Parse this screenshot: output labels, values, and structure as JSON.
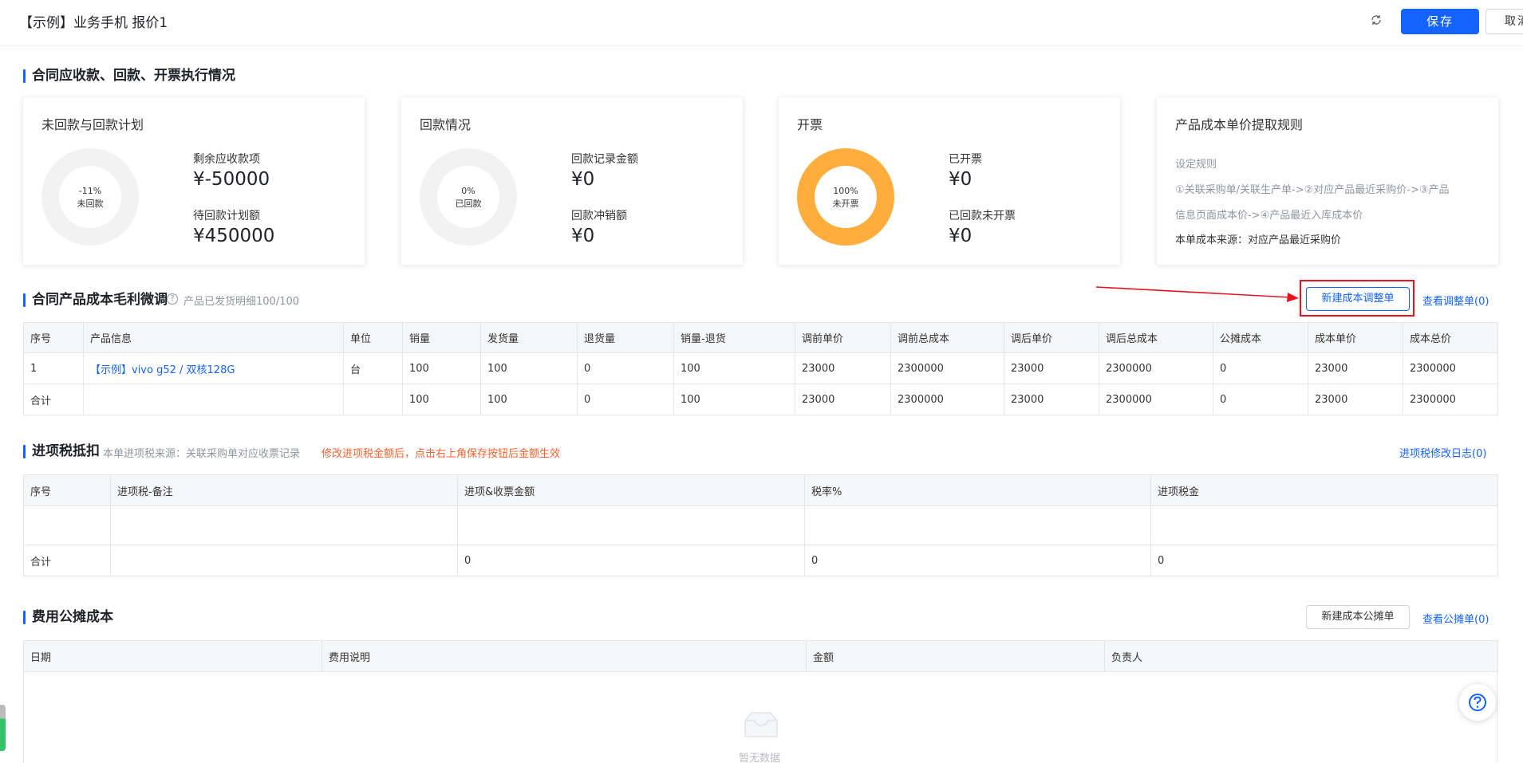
{
  "header": {
    "title": "【示例】业务手机 报价1",
    "refresh_icon": "refresh-icon",
    "save_label": "保存",
    "cancel_label": "取消"
  },
  "section1": {
    "title": "合同应收款、回款、开票执行情况",
    "cards": [
      {
        "title": "未回款与回款计划",
        "donut_percent": "-11%",
        "donut_label": "未回款",
        "donut_fill": 0,
        "stat1_label": "剩余应收款项",
        "stat1_value": "¥-50000",
        "stat2_label": "待回款计划额",
        "stat2_value": "¥450000"
      },
      {
        "title": "回款情况",
        "donut_percent": "0%",
        "donut_label": "已回款",
        "donut_fill": 0,
        "stat1_label": "回款记录金额",
        "stat1_value": "¥0",
        "stat2_label": "回款冲销额",
        "stat2_value": "¥0"
      },
      {
        "title": "开票",
        "donut_percent": "100%",
        "donut_label": "未开票",
        "donut_fill": 1,
        "stat1_label": "已开票",
        "stat1_value": "¥0",
        "stat2_label": "已回款未开票",
        "stat2_value": "¥0"
      }
    ],
    "rule_card": {
      "title": "产品成本单价提取规则",
      "rule_label": "设定规则",
      "rule_line1": "①关联采购单/关联生产单->②对应产品最近采购价->③产品",
      "rule_line2": "信息页面成本价->④产品最近入库成本价",
      "source": "本单成本来源：对应产品最近采购价"
    }
  },
  "section2": {
    "title": "合同产品成本毛利微调",
    "hint": "产品已发货明细100/100",
    "new_button": "新建成本调整单",
    "view_link": "查看调整单(0)",
    "columns": [
      "序号",
      "产品信息",
      "单位",
      "销量",
      "发货量",
      "退货量",
      "销量-退货",
      "调前单价",
      "调前总成本",
      "调后单价",
      "调后总成本",
      "公摊成本",
      "成本单价",
      "成本总价"
    ],
    "rows": [
      [
        "1",
        "【示例】vivo g52 / 双核128G",
        "台",
        "100",
        "100",
        "0",
        "100",
        "23000",
        "2300000",
        "23000",
        "2300000",
        "0",
        "23000",
        "2300000"
      ],
      [
        "合计",
        "",
        "",
        "100",
        "100",
        "0",
        "100",
        "23000",
        "2300000",
        "23000",
        "2300000",
        "0",
        "23000",
        "2300000"
      ]
    ]
  },
  "section3": {
    "title": "进项税抵扣",
    "hint": "本单进项税来源：关联采购单对应收票记录",
    "warn": "修改进项税金额后，点击右上角保存按钮后金额生效",
    "log_link": "进项税修改日志(0)",
    "columns": [
      "序号",
      "进项税-备注",
      "进项&收票金额",
      "税率%",
      "进项税金"
    ],
    "rows": [
      [
        "",
        "",
        "",
        "",
        ""
      ],
      [
        "合计",
        "",
        "0",
        "0",
        "0"
      ]
    ]
  },
  "section4": {
    "title": "费用公摊成本",
    "new_button": "新建成本公摊单",
    "view_link": "查看公摊单(0)",
    "columns": [
      "日期",
      "费用说明",
      "金额",
      "负责人"
    ],
    "empty_text": "暂无数据"
  },
  "colors": {
    "primary": "#1463ff",
    "donut_track": "#f2f2f2",
    "donut_fill": "#ffae3d",
    "warning": "#f5622d",
    "annotation_red": "#e8131f"
  }
}
